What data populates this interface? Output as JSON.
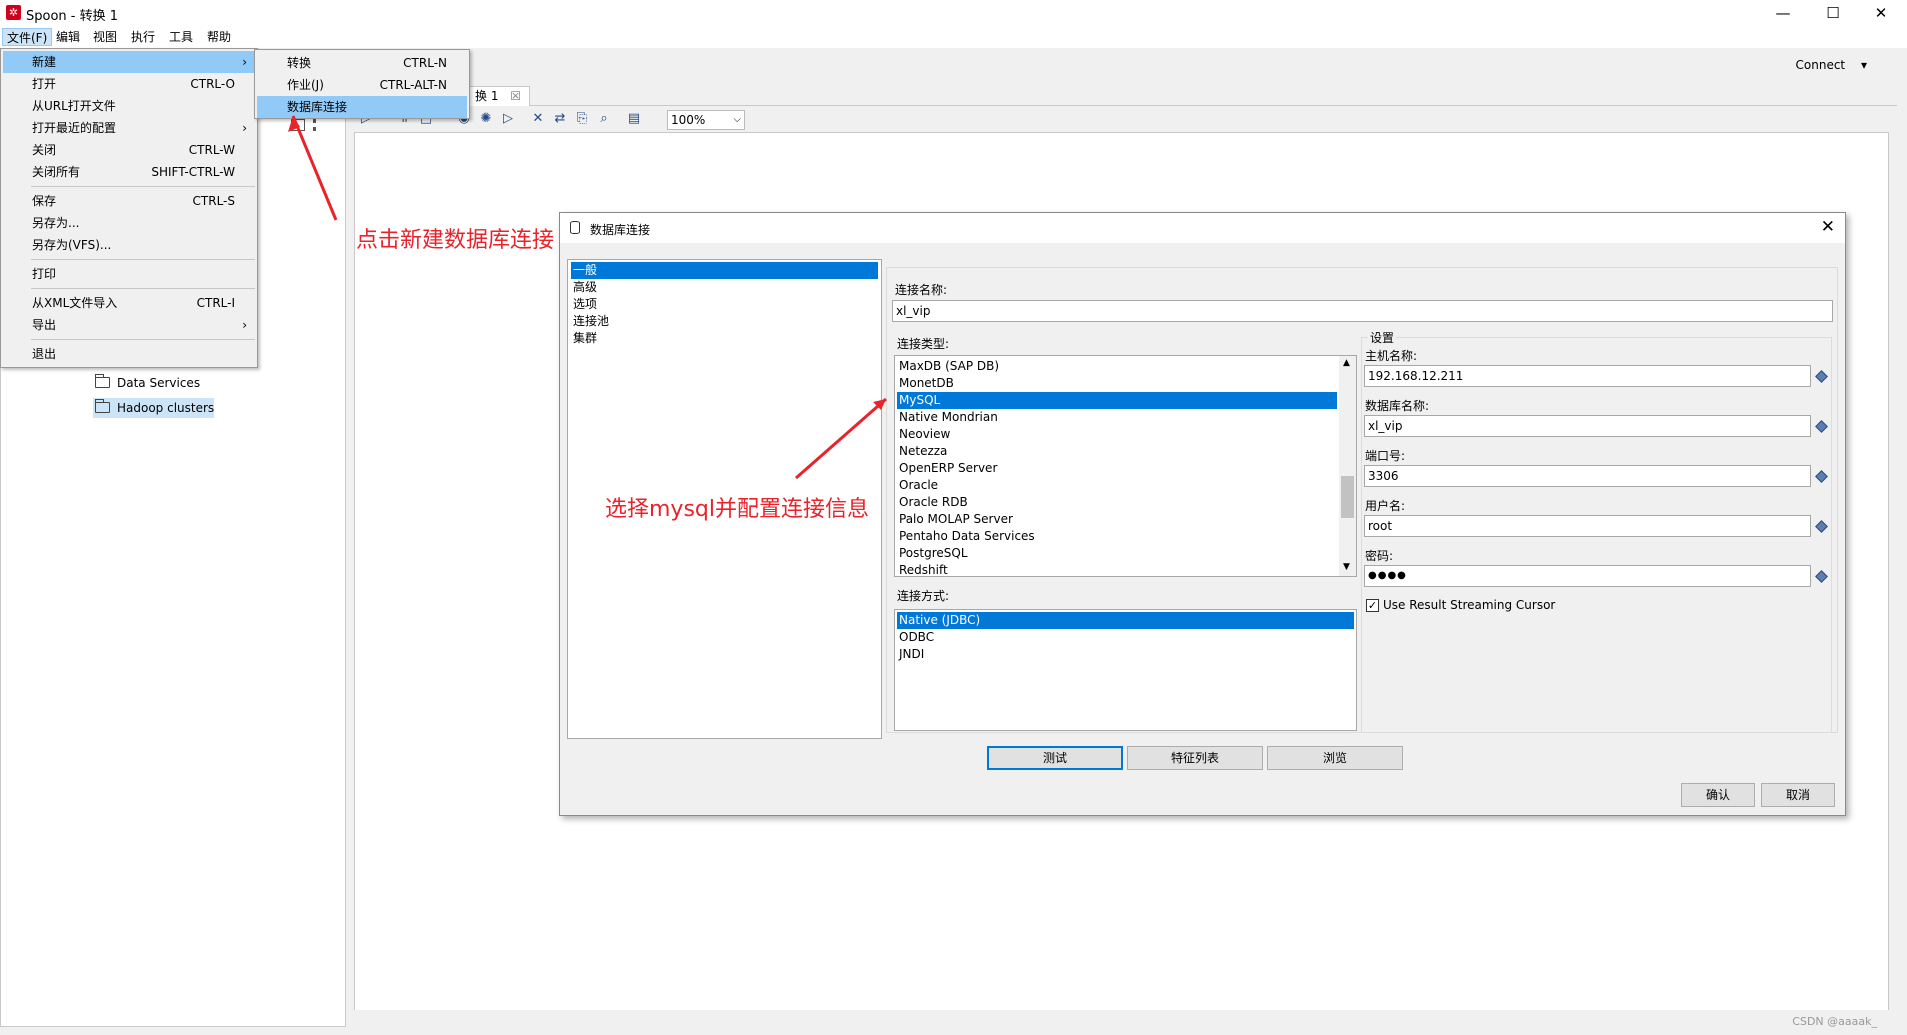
{
  "window": {
    "title": "Spoon - 转换 1",
    "minimize": "—",
    "maximize": "☐",
    "close": "✕"
  },
  "menubar": {
    "items": [
      "文件(F)",
      "编辑",
      "视图",
      "执行",
      "工具",
      "帮助"
    ]
  },
  "connect": {
    "label": "Connect",
    "arrow": "▾"
  },
  "tab": {
    "label": "换 1",
    "close": "☒"
  },
  "zoom": {
    "value": "100%"
  },
  "tree": {
    "items": [
      "Data Services",
      "Hadoop clusters"
    ]
  },
  "file_menu": {
    "items": [
      {
        "label": "新建",
        "shortcut": "",
        "arrow": "›"
      },
      {
        "label": "打开",
        "shortcut": "CTRL-O",
        "arrow": ""
      },
      {
        "label": "从URL打开文件",
        "shortcut": "",
        "arrow": ""
      },
      {
        "label": "打开最近的配置",
        "shortcut": "",
        "arrow": "›"
      },
      {
        "label": "关闭",
        "shortcut": "CTRL-W",
        "arrow": ""
      },
      {
        "label": "关闭所有",
        "shortcut": "SHIFT-CTRL-W",
        "arrow": ""
      },
      {
        "label": "保存",
        "shortcut": "CTRL-S",
        "arrow": ""
      },
      {
        "label": "另存为...",
        "shortcut": "",
        "arrow": ""
      },
      {
        "label": "另存为(VFS)...",
        "shortcut": "",
        "arrow": ""
      },
      {
        "label": "打印",
        "shortcut": "",
        "arrow": ""
      },
      {
        "label": "从XML文件导入",
        "shortcut": "CTRL-I",
        "arrow": ""
      },
      {
        "label": "导出",
        "shortcut": "",
        "arrow": "›"
      },
      {
        "label": "退出",
        "shortcut": "",
        "arrow": ""
      }
    ]
  },
  "new_submenu": {
    "items": [
      {
        "label": "转换",
        "shortcut": "CTRL-N"
      },
      {
        "label": "作业(J)",
        "shortcut": "CTRL-ALT-N"
      },
      {
        "label": "数据库连接",
        "shortcut": ""
      }
    ]
  },
  "dialog": {
    "title": "数据库连接",
    "close": "✕",
    "nav": [
      "一般",
      "高级",
      "选项",
      "连接池",
      "集群"
    ],
    "connection_name_label": "连接名称:",
    "connection_name": "xl_vip",
    "connection_type_label": "连接类型:",
    "connection_types": [
      "MaxDB (SAP DB)",
      "MonetDB",
      "MySQL",
      "Native Mondrian",
      "Neoview",
      "Netezza",
      "OpenERP Server",
      "Oracle",
      "Oracle RDB",
      "Palo MOLAP Server",
      "Pentaho Data Services",
      "PostgreSQL",
      "Redshift"
    ],
    "selected_type": "MySQL",
    "access_label": "连接方式:",
    "access_methods": [
      "Native (JDBC)",
      "ODBC",
      "JNDI"
    ],
    "settings_label": "设置",
    "host_label": "主机名称:",
    "host": "192.168.12.211",
    "db_label": "数据库名称:",
    "db": "xl_vip",
    "port_label": "端口号:",
    "port": "3306",
    "user_label": "用户名:",
    "user": "root",
    "password_label": "密码:",
    "password": "●●●●",
    "streaming_label": "Use Result Streaming Cursor",
    "buttons": {
      "test": "测试",
      "features": "特征列表",
      "explore": "浏览",
      "ok": "确认",
      "cancel": "取消"
    }
  },
  "annotations": {
    "step1": "点击新建数据库连接",
    "step2": "选择mysql并配置连接信息"
  },
  "watermark": "CSDN @aaaak_",
  "colors": {
    "selection": "#0078d7",
    "menu_highlight": "#91c9f7",
    "annotation": "#e8232a"
  }
}
